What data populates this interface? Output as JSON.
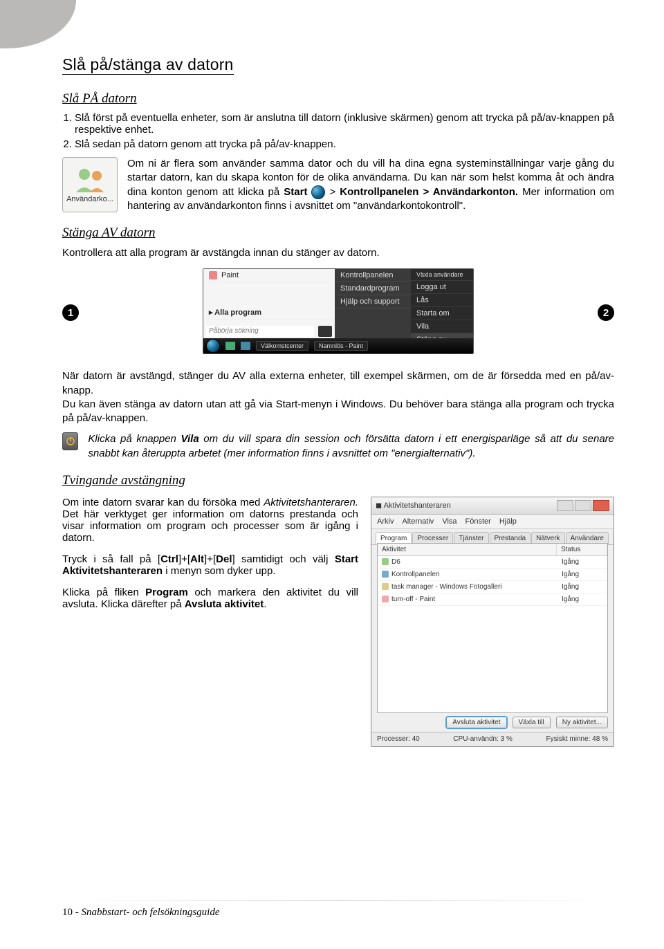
{
  "title": "Slå på/stänga av datorn",
  "section1": {
    "heading": "Slå PÅ datorn",
    "steps": [
      "Slå först på eventuella enheter, som är anslutna till datorn (inklusive skärmen) genom att trycka på på/av-knappen på respektive enhet.",
      "Slå sedan på datorn genom att trycka på på/av-knappen."
    ],
    "user_icon_caption": "Användarko...",
    "info_a": "Om ni är flera som använder samma dator och du vill ha dina egna systeminställningar varje gång du startar datorn, kan du skapa konton för de olika användarna. Du kan när som helst komma åt och ändra dina konton genom att klicka på ",
    "info_b": "Start",
    "info_c": " > ",
    "info_d": "Kontrollpanelen > Användarkonton.",
    "info_e": " Mer information om hantering av användarkonton finns i avsnittet om \"användarkontokontroll\"."
  },
  "section2": {
    "heading": "Stänga AV datorn",
    "intro": "Kontrollera att alla program är avstängda innan du stänger av datorn.",
    "startmenu": {
      "left": [
        "Paint",
        "Alla program"
      ],
      "search": "Påbörja sökning",
      "right": [
        "Kontrollpanelen",
        "Standardprogram",
        "Hjälp och support"
      ],
      "far": [
        "Växla användare",
        "Logga ut",
        "Lås",
        "Starta om",
        "Vila",
        "Stäng av"
      ],
      "taskbar": [
        "Välkomstcenter",
        "Namnlös - Paint"
      ]
    },
    "after_a": "När datorn är avstängd, stänger du AV alla externa enheter, till exempel skärmen, om de är försedda med en på/av-knapp.",
    "after_b": "Du kan även stänga av datorn utan att gå via Start-menyn i Windows. Du behöver bara stänga alla program och trycka på på/av-knappen.",
    "hibernate_a": "Klicka på knappen ",
    "hibernate_b": "Vila",
    "hibernate_c": " om du vill spara din session och försätta datorn i ett energisparläge så att du senare snabbt kan återuppta arbetet (mer information finns i avsnittet om \"energialternativ\")."
  },
  "section3": {
    "heading": "Tvingande avstängning",
    "para1_a": "Om inte datorn svarar kan du försöka med ",
    "para1_b": "Aktivitetshanteraren.",
    "para1_c": " Det här verktyget ger information om datorns prestanda och visar information om program och processer som är igång i datorn.",
    "para2_a": "Tryck i så fall på [",
    "para2_b": "Ctrl",
    "para2_c": "]+[",
    "para2_d": "Alt",
    "para2_e": "]+[",
    "para2_f": "Del",
    "para2_g": "] samtidigt och välj ",
    "para2_h": "Start Aktivitetshanteraren",
    "para2_i": " i menyn som dyker upp.",
    "para3_a": "Klicka på fliken ",
    "para3_b": "Program",
    "para3_c": " och markera den aktivitet du vill avsluta. Klicka därefter på ",
    "para3_d": "Avsluta aktivitet",
    "para3_e": "."
  },
  "taskmgr": {
    "title": "Aktivitetshanteraren",
    "menu": [
      "Arkiv",
      "Alternativ",
      "Visa",
      "Fönster",
      "Hjälp"
    ],
    "tabs": [
      "Program",
      "Processer",
      "Tjänster",
      "Prestanda",
      "Nätverk",
      "Användare"
    ],
    "cols": [
      "Aktivitet",
      "Status"
    ],
    "rows": [
      {
        "name": "D6",
        "status": "Igång"
      },
      {
        "name": "Kontrollpanelen",
        "status": "Igång"
      },
      {
        "name": "task manager - Windows Fotogalleri",
        "status": "Igång"
      },
      {
        "name": "turn-off - Paint",
        "status": "Igång"
      }
    ],
    "buttons": [
      "Avsluta aktivitet",
      "Växla till",
      "Ny aktivitet..."
    ],
    "status": [
      "Processer: 40",
      "CPU-användn: 3 %",
      "Fysiskt minne: 48 %"
    ]
  },
  "footer": {
    "page": "10",
    "book": "Snabbstart- och felsökningsguide"
  }
}
